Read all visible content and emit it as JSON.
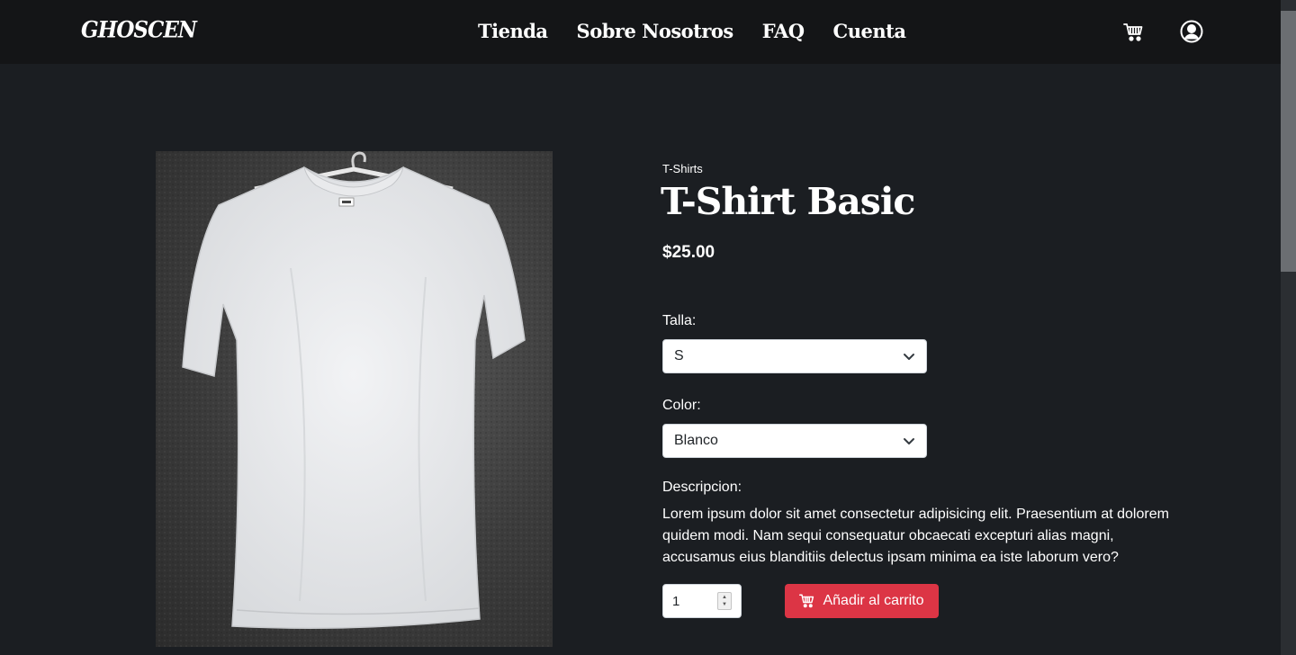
{
  "nav": {
    "logo_text": "GHOSCEN",
    "links": [
      "Tienda",
      "Sobre Nosotros",
      "FAQ",
      "Cuenta"
    ],
    "cart_icon": "cart-icon",
    "account_icon": "user-circle-icon"
  },
  "product": {
    "category": "T-Shirts",
    "title": "T-Shirt Basic",
    "price": "$25.00",
    "size_label": "Talla:",
    "size_value": "S",
    "color_label": "Color:",
    "color_value": "Blanco",
    "description_label": "Descripcion:",
    "description": "Lorem ipsum dolor sit amet consectetur adipisicing elit. Praesentium at dolorem quidem modi. Nam sequi consequatur obcaecati excepturi alias magni, accusamus eius blanditiis delectus ipsam minima ea iste laborum vero?",
    "quantity": "1",
    "add_to_cart_label": "Añadir al carrito"
  },
  "colors": {
    "background": "#1b1e22",
    "navbar": "#141517",
    "accent": "#dc3545"
  }
}
